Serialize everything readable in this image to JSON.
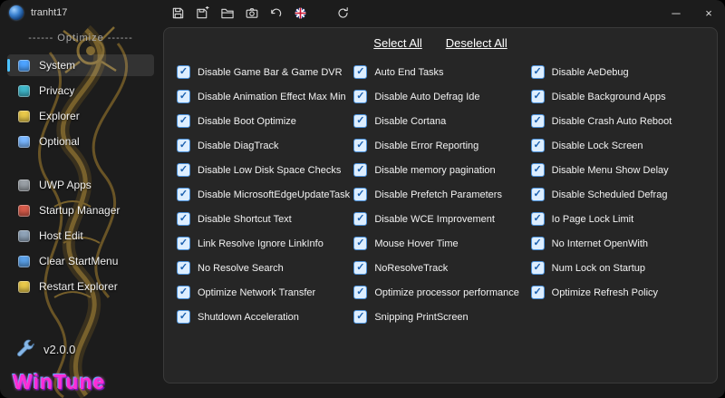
{
  "titlebar": {
    "username": "tranht17",
    "toolbar_icons": [
      "save-icon",
      "save-as-icon",
      "open-folder-icon",
      "screenshot-icon",
      "undo-icon",
      "language-flag-icon",
      "refresh-icon"
    ],
    "controls": {
      "minimize": "─",
      "close": "×"
    }
  },
  "sidebar": {
    "section_label": "------ Optimize ------",
    "items": [
      {
        "label": "System",
        "icon": "system-monitor-icon",
        "color": "#4da3ff",
        "selected": true
      },
      {
        "label": "Privacy",
        "icon": "privacy-shield-icon",
        "color": "#3fb6c9"
      },
      {
        "label": "Explorer",
        "icon": "explorer-folder-icon",
        "color": "#e8c84a"
      },
      {
        "label": "Optional",
        "icon": "optional-icon",
        "color": "#7ab7ff",
        "gap_after": true
      },
      {
        "label": "UWP Apps",
        "icon": "uwp-apps-icon",
        "color": "#9aa0a6"
      },
      {
        "label": "Startup Manager",
        "icon": "startup-manager-icon",
        "color": "#d65b4a"
      },
      {
        "label": "Host Edit",
        "icon": "host-edit-icon",
        "color": "#8fa3b8"
      },
      {
        "label": "Clear StartMenu",
        "icon": "clear-startmenu-icon",
        "color": "#5aa0e8"
      },
      {
        "label": "Restart Explorer",
        "icon": "restart-explorer-icon",
        "color": "#e8c84a"
      }
    ],
    "version": "v2.0.0",
    "logo_text": "WinTune",
    "logo_color": "#ff2bd6"
  },
  "main": {
    "select_all_label": "Select All",
    "deselect_all_label": "Deselect All",
    "checkbox_checked_glyph": "✓",
    "accent_color": "#4a90d9",
    "columns": [
      [
        "Disable Game Bar & Game DVR",
        "Disable Animation Effect Max Min",
        "Disable Boot Optimize",
        "Disable DiagTrack",
        "Disable Low Disk Space Checks",
        "Disable MicrosoftEdgeUpdateTask",
        "Disable Shortcut Text",
        "Link Resolve Ignore LinkInfo",
        "No Resolve Search",
        "Optimize Network Transfer",
        "Shutdown Acceleration"
      ],
      [
        "Auto End Tasks",
        "Disable Auto Defrag Ide",
        "Disable Cortana",
        "Disable Error Reporting",
        "Disable memory pagination",
        "Disable Prefetch Parameters",
        "Disable WCE Improvement",
        "Mouse Hover Time",
        "NoResolveTrack",
        "Optimize processor performance",
        "Snipping PrintScreen"
      ],
      [
        "Disable AeDebug",
        "Disable Background Apps",
        "Disable Crash Auto Reboot",
        "Disable Lock Screen",
        "Disable Menu Show Delay",
        "Disable Scheduled Defrag",
        "Io Page Lock Limit",
        "No Internet OpenWith",
        "Num Lock on Startup",
        "Optimize Refresh Policy"
      ]
    ]
  }
}
